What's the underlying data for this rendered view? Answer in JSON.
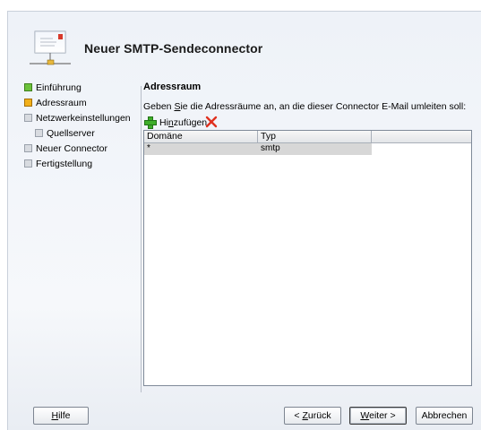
{
  "window": {
    "title": "Neuer SMTP-Sendeconnector"
  },
  "nav": {
    "items": [
      {
        "label": "Einführung",
        "status": "done",
        "indent": false
      },
      {
        "label": "Adressraum",
        "status": "current",
        "indent": false
      },
      {
        "label": "Netzwerkeinstellungen",
        "status": "todo",
        "indent": false
      },
      {
        "label": "Quellserver",
        "status": "todo",
        "indent": true
      },
      {
        "label": "Neuer Connector",
        "status": "todo",
        "indent": false
      },
      {
        "label": "Fertigstellung",
        "status": "todo",
        "indent": false
      }
    ]
  },
  "content": {
    "section_title": "Adressraum",
    "description_pre": "Geben ",
    "description_accel": "S",
    "description_post": "ie die Adressräume an, an die dieser Connector E-Mail umleiten soll:",
    "add_pre": "Hi",
    "add_accel": "n",
    "add_post": "zufügen",
    "delete_icon": "delete-x-icon",
    "add_icon": "green-plus-icon"
  },
  "grid": {
    "columns": [
      "Domäne",
      "Typ"
    ],
    "rows": [
      {
        "domain": "*",
        "type": "smtp",
        "selected": true
      }
    ]
  },
  "buttons": {
    "help": {
      "accel": "H",
      "rest": "ilfe"
    },
    "back": {
      "pre": "< ",
      "accel": "Z",
      "rest": "urück"
    },
    "next": {
      "accel": "W",
      "rest": "eiter >"
    },
    "cancel": {
      "label": "Abbrechen"
    }
  },
  "colors": {
    "done": "#6cc23a",
    "current": "#f2b019",
    "todo": "#d8dbe0",
    "selection": "#d7d7d7"
  }
}
